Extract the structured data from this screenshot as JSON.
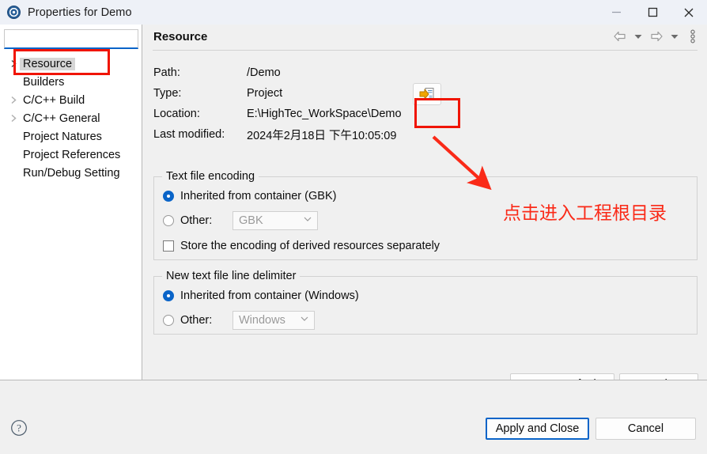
{
  "window": {
    "title": "Properties for Demo",
    "icon": "eclipse-icon",
    "controls": {
      "minimize": "minimize-icon",
      "maximize": "maximize-icon",
      "close": "close-icon"
    }
  },
  "sidebar": {
    "filter": {
      "value": "",
      "placeholder": ""
    },
    "items": [
      {
        "label": "Resource",
        "expandable": true,
        "selected": true
      },
      {
        "label": "Builders",
        "expandable": false,
        "selected": false
      },
      {
        "label": "C/C++ Build",
        "expandable": true,
        "selected": false
      },
      {
        "label": "C/C++ General",
        "expandable": true,
        "selected": false
      },
      {
        "label": "Project Natures",
        "expandable": false,
        "selected": false
      },
      {
        "label": "Project References",
        "expandable": false,
        "selected": false
      },
      {
        "label": "Run/Debug Setting",
        "expandable": false,
        "selected": false
      }
    ]
  },
  "content": {
    "title": "Resource",
    "toolbar": {
      "back": "back-arrow-icon",
      "back_menu": "chevron-down-icon",
      "forward": "forward-arrow-icon",
      "forward_menu": "chevron-down-icon",
      "more": "view-menu-icon"
    },
    "properties": [
      {
        "label": "Path:",
        "value": "/Demo"
      },
      {
        "label": "Type:",
        "value": "Project"
      },
      {
        "label": "Location:",
        "value": "E:\\HighTec_WorkSpace\\Demo"
      },
      {
        "label": "Last modified:",
        "value": "2024年2月18日 下午10:05:09"
      }
    ],
    "browse_button": "open-folder-icon",
    "encoding_group": {
      "title": "Text file encoding",
      "inherited_label": "Inherited from container (GBK)",
      "inherited_selected": true,
      "other_label": "Other:",
      "other_selected": false,
      "other_value": "GBK",
      "store_label": "Store the encoding of derived resources separately",
      "store_checked": false
    },
    "delimiter_group": {
      "title": "New text file line delimiter",
      "inherited_label": "Inherited from container (Windows)",
      "inherited_selected": true,
      "other_label": "Other:",
      "other_selected": false,
      "other_value": "Windows"
    },
    "restore_label": "Restore Defaults",
    "apply_label": "Apply"
  },
  "footer": {
    "help": "help-icon",
    "apply_close_label": "Apply and Close",
    "cancel_label": "Cancel"
  },
  "annotations": {
    "note_text": "点击进入工程根目录",
    "color": "#fa2a18"
  }
}
